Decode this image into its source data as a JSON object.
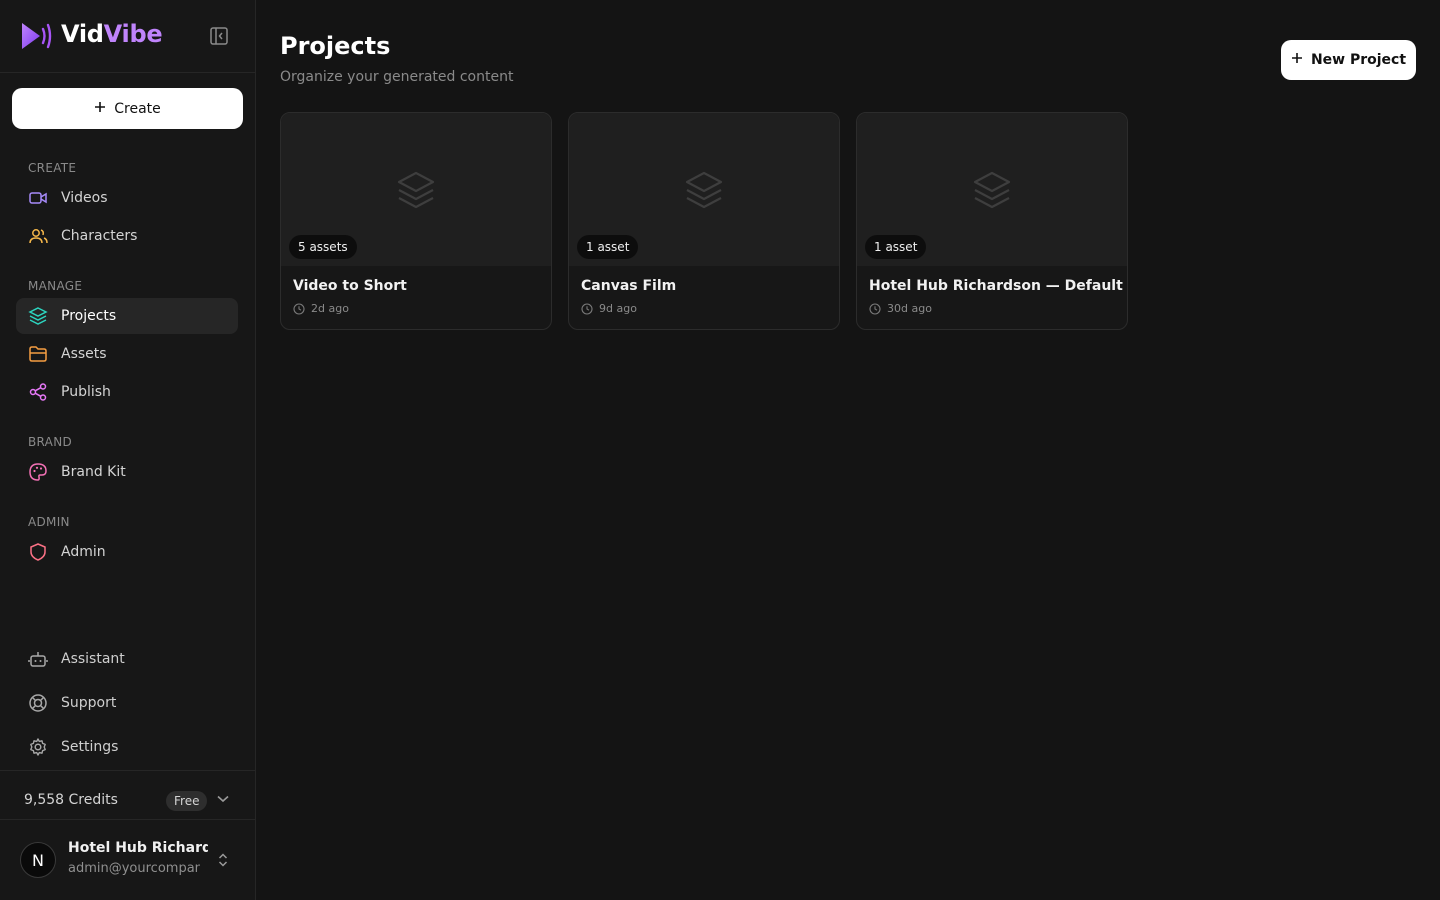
{
  "brand": {
    "name_part1": "Vid",
    "name_part2": "Vibe"
  },
  "sidebar": {
    "create_button": "Create",
    "sections": [
      {
        "label": "CREATE",
        "items": [
          {
            "label": "Videos",
            "icon": "video-icon",
            "color": "#a78bfa"
          },
          {
            "label": "Characters",
            "icon": "users-icon",
            "color": "#f5b74a"
          }
        ]
      },
      {
        "label": "MANAGE",
        "items": [
          {
            "label": "Projects",
            "icon": "layers-icon",
            "color": "#2dd4bf",
            "active": true
          },
          {
            "label": "Assets",
            "icon": "folder-icon",
            "color": "#f59e42"
          },
          {
            "label": "Publish",
            "icon": "share-icon",
            "color": "#e879f9"
          }
        ]
      },
      {
        "label": "BRAND",
        "items": [
          {
            "label": "Brand Kit",
            "icon": "palette-icon",
            "color": "#f472b6"
          }
        ]
      },
      {
        "label": "ADMIN",
        "items": [
          {
            "label": "Admin",
            "icon": "shield-icon",
            "color": "#fb7185"
          }
        ]
      }
    ],
    "bottom": [
      {
        "label": "Assistant",
        "icon": "bot-icon"
      },
      {
        "label": "Support",
        "icon": "life-buoy-icon"
      },
      {
        "label": "Settings",
        "icon": "gear-icon"
      }
    ],
    "credits": {
      "text": "9,558 Credits",
      "plan": "Free"
    },
    "user": {
      "initial": "N",
      "name": "Hotel Hub Richardson",
      "email": "admin@yourcompany.com"
    }
  },
  "main": {
    "title": "Projects",
    "subtitle": "Organize your generated content",
    "new_project_button": "New Project",
    "projects": [
      {
        "count": "5 assets",
        "title": "Video to Short",
        "time": "2d ago"
      },
      {
        "count": "1 asset",
        "title": "Canvas Film",
        "time": "9d ago"
      },
      {
        "count": "1 asset",
        "title": "Hotel Hub Richardson — Default",
        "time": "30d ago"
      }
    ]
  }
}
